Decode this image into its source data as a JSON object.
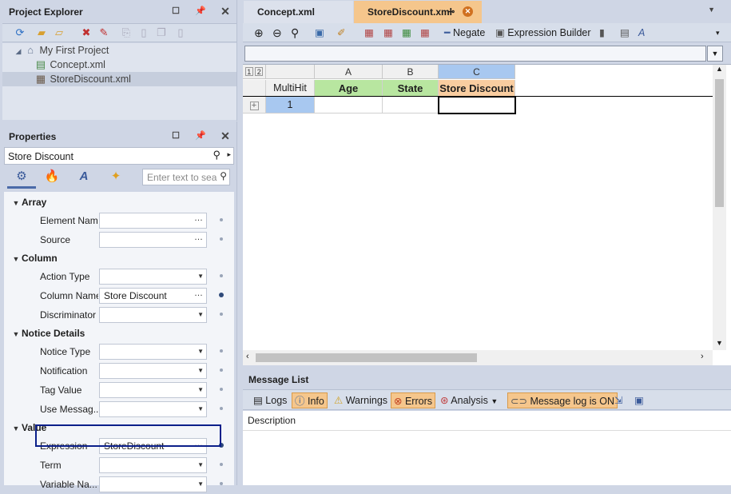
{
  "project_explorer": {
    "title": "Project Explorer",
    "tree": [
      {
        "label": "My First Project"
      },
      {
        "label": "Concept.xml"
      },
      {
        "label": "StoreDiscount.xml"
      }
    ]
  },
  "properties": {
    "title": "Properties",
    "search_value": "Store Discount",
    "filter_placeholder": "Enter text to sea",
    "categories": [
      {
        "name": "Array",
        "rows": [
          {
            "label": "Element Name",
            "value": "",
            "editor": "ellipsis"
          },
          {
            "label": "Source",
            "value": "",
            "editor": "ellipsis"
          }
        ]
      },
      {
        "name": "Column",
        "rows": [
          {
            "label": "Action Type",
            "value": "",
            "editor": "dropdown"
          },
          {
            "label": "Column Name",
            "value": "Store Discount",
            "editor": "ellipsis"
          },
          {
            "label": "Discriminator",
            "value": "",
            "editor": "dropdown"
          }
        ]
      },
      {
        "name": "Notice Details",
        "rows": [
          {
            "label": "Notice Type",
            "value": "",
            "editor": "dropdown"
          },
          {
            "label": "Notification",
            "value": "",
            "editor": "dropdown"
          },
          {
            "label": "Tag Value",
            "value": "",
            "editor": "dropdown"
          },
          {
            "label": "Use Messag...",
            "value": "",
            "editor": "dropdown"
          }
        ]
      },
      {
        "name": "Value",
        "rows": [
          {
            "label": "Expression",
            "value": "StoreDiscount",
            "editor": "ellipsis"
          },
          {
            "label": "Term",
            "value": "",
            "editor": "dropdown"
          },
          {
            "label": "Variable Na...",
            "value": "",
            "editor": "dropdown"
          }
        ]
      }
    ]
  },
  "tabs": [
    {
      "label": "Concept.xml"
    },
    {
      "label": "StoreDiscount.xml"
    }
  ],
  "toolbar": {
    "negate": "Negate",
    "expression_builder": "Expression Builder"
  },
  "sheet": {
    "level_buttons": [
      "1",
      "2"
    ],
    "columns": [
      "A",
      "B",
      "C"
    ],
    "headers": [
      "MultiHit",
      "Age",
      "State",
      "Store Discount"
    ],
    "row_values": [
      "1",
      "",
      "",
      ""
    ]
  },
  "message_list": {
    "title": "Message List",
    "logs": "Logs",
    "info": "Info",
    "warnings": "Warnings",
    "errors": "Errors",
    "analysis": "Analysis",
    "log_state": "Message log is ON",
    "col_description": "Description"
  },
  "colors": {
    "accent_tab": "#f5c68c",
    "header_green": "#b8e6a0",
    "header_orange": "#f9cda0",
    "highlight_box": "#0b1f8a"
  }
}
